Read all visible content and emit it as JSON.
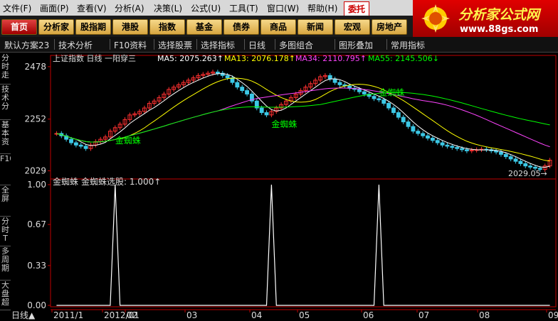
{
  "menubar": {
    "items": [
      "文件(F)",
      "画面(P)",
      "查看(V)",
      "分析(A)",
      "决策(L)",
      "公式(U)",
      "工具(T)",
      "窗口(W)",
      "帮助(H)"
    ],
    "delegate_button": "委托"
  },
  "navbar": {
    "buttons": [
      "首页",
      "分析家",
      "股指期",
      "港股",
      "指数",
      "基金",
      "债券",
      "商品",
      "新闻",
      "宏观",
      "房地产"
    ]
  },
  "brand": {
    "title": "分析家公式网",
    "url": "www.88gs.com"
  },
  "toolbar": {
    "items": [
      "默认方案23",
      "技术分析",
      "F10资料",
      "选择股票",
      "选择指标",
      "日线",
      "多图组合",
      "图形叠加",
      "常用指标"
    ]
  },
  "side_tabs": [
    "分时走",
    "技术分",
    "基本资",
    "F10",
    "全屏",
    "分时T",
    "多周期",
    "大盘超"
  ],
  "main_chart": {
    "title": "上证指数 日线 一阳穿三",
    "ma": [
      {
        "label": "MA5: 2075.263↑",
        "color": "#ffffff"
      },
      {
        "label": "MA13: 2076.178↑",
        "color": "#ffff00"
      },
      {
        "label": "MA34: 2110.795↑",
        "color": "#ff44ff"
      },
      {
        "label": "MA55: 2145.506↓",
        "color": "#00ff00"
      }
    ],
    "y_ticks": [
      "2478",
      "2252",
      "2029"
    ],
    "signal_label": "金蜘蛛",
    "low_label": "2029.05→",
    "colors": {
      "up": "#ff3030",
      "down": "#3cc8e6",
      "axis": "#c00000",
      "grid": "#700000"
    }
  },
  "indicator": {
    "name": "金蜘蛛",
    "formula_label": "金蜘蛛选股: 1.000↑",
    "y_ticks": [
      "1.00",
      "0.67",
      "0.33",
      "0.00"
    ]
  },
  "x_axis": {
    "period_label": "日线▲",
    "labels": [
      "2011/1",
      "2012/01",
      "02",
      "03",
      "04",
      "05",
      "06",
      "07",
      "08",
      "09"
    ]
  },
  "chart_data": {
    "type": "candlestick",
    "title": "上证指数 日线 一阳穿三",
    "series": [
      {
        "name": "MA5",
        "value": 2075.263
      },
      {
        "name": "MA13",
        "value": 2076.178
      },
      {
        "name": "MA34",
        "value": 2110.795
      },
      {
        "name": "MA55",
        "value": 2145.506
      }
    ],
    "y_ticks": [
      2478,
      2252,
      2029
    ],
    "ylim": [
      2000,
      2490
    ],
    "close": [
      2190,
      2180,
      2165,
      2150,
      2140,
      2135,
      2125,
      2140,
      2155,
      2165,
      2175,
      2200,
      2215,
      2230,
      2250,
      2270,
      2275,
      2285,
      2300,
      2320,
      2330,
      2345,
      2360,
      2380,
      2390,
      2400,
      2410,
      2420,
      2430,
      2440,
      2445,
      2450,
      2455,
      2450,
      2440,
      2430,
      2410,
      2390,
      2375,
      2360,
      2330,
      2300,
      2280,
      2270,
      2285,
      2300,
      2315,
      2330,
      2345,
      2360,
      2375,
      2390,
      2405,
      2420,
      2435,
      2440,
      2425,
      2410,
      2400,
      2395,
      2385,
      2380,
      2370,
      2360,
      2350,
      2340,
      2335,
      2320,
      2300,
      2280,
      2260,
      2240,
      2220,
      2200,
      2190,
      2180,
      2170,
      2160,
      2150,
      2140,
      2135,
      2130,
      2125,
      2120,
      2115,
      2118,
      2120,
      2122,
      2120,
      2115,
      2110,
      2100,
      2090,
      2080,
      2070,
      2060,
      2050,
      2045,
      2040,
      2035,
      2050,
      2075
    ],
    "indicator_signals": [
      12,
      44,
      66
    ],
    "indicator_ylim": [
      0,
      1
    ]
  }
}
